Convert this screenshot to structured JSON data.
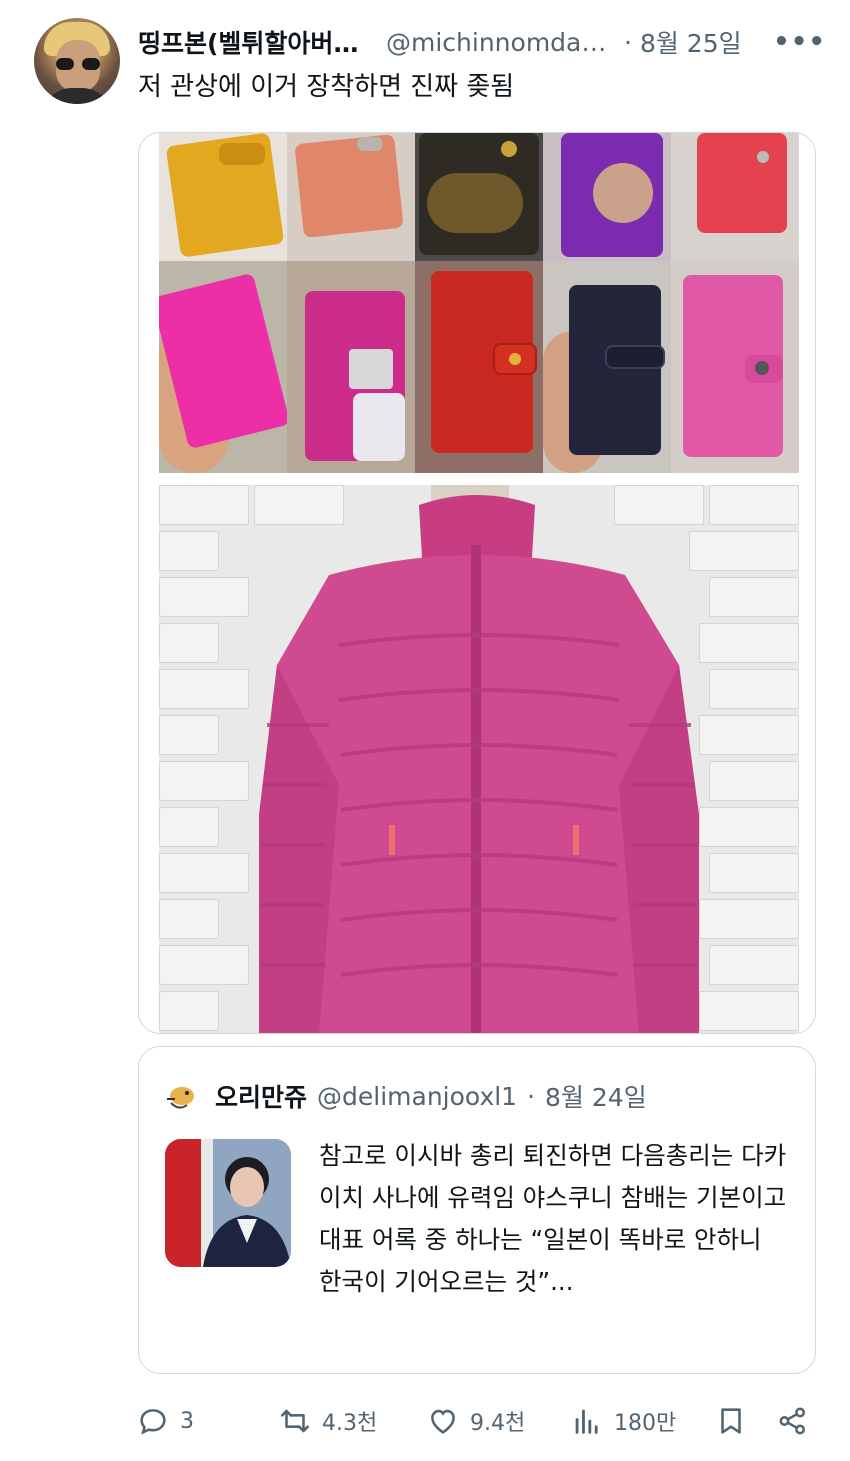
{
  "tweet": {
    "author_name": "띵프본(벨튀할아버지)",
    "author_handle": "@michinnomdaebal",
    "date": "8월 25일",
    "more_label": "•••",
    "text": "저 관상에 이거 장착하면 진짜 좆됨",
    "avatar_icon": "user-avatar"
  },
  "quote": {
    "author_name": "오리만쥬",
    "author_handle": "@delimanjooxl1",
    "separator": "·",
    "date": "8월 24일",
    "text": "참고로 이시바 총리 퇴진하면 다음총리는 다카이치 사나에 유력임 야스쿠니 참배는 기본이고 대표 어록 중 하나는 “일본이 똑바로 안하니 한국이 기어오르는 것”..."
  },
  "actions": {
    "reply_count": "3",
    "retweet_count": "4.3천",
    "like_count": "9.4천",
    "view_count": "180만"
  },
  "colors": {
    "text_primary": "#0f1419",
    "text_secondary": "#536471",
    "border": "#cfd9de",
    "jacket_pink": "#d04a8f"
  },
  "icons": [
    "reply-icon",
    "retweet-icon",
    "like-icon",
    "views-icon",
    "bookmark-icon",
    "share-icon",
    "more-icon"
  ]
}
